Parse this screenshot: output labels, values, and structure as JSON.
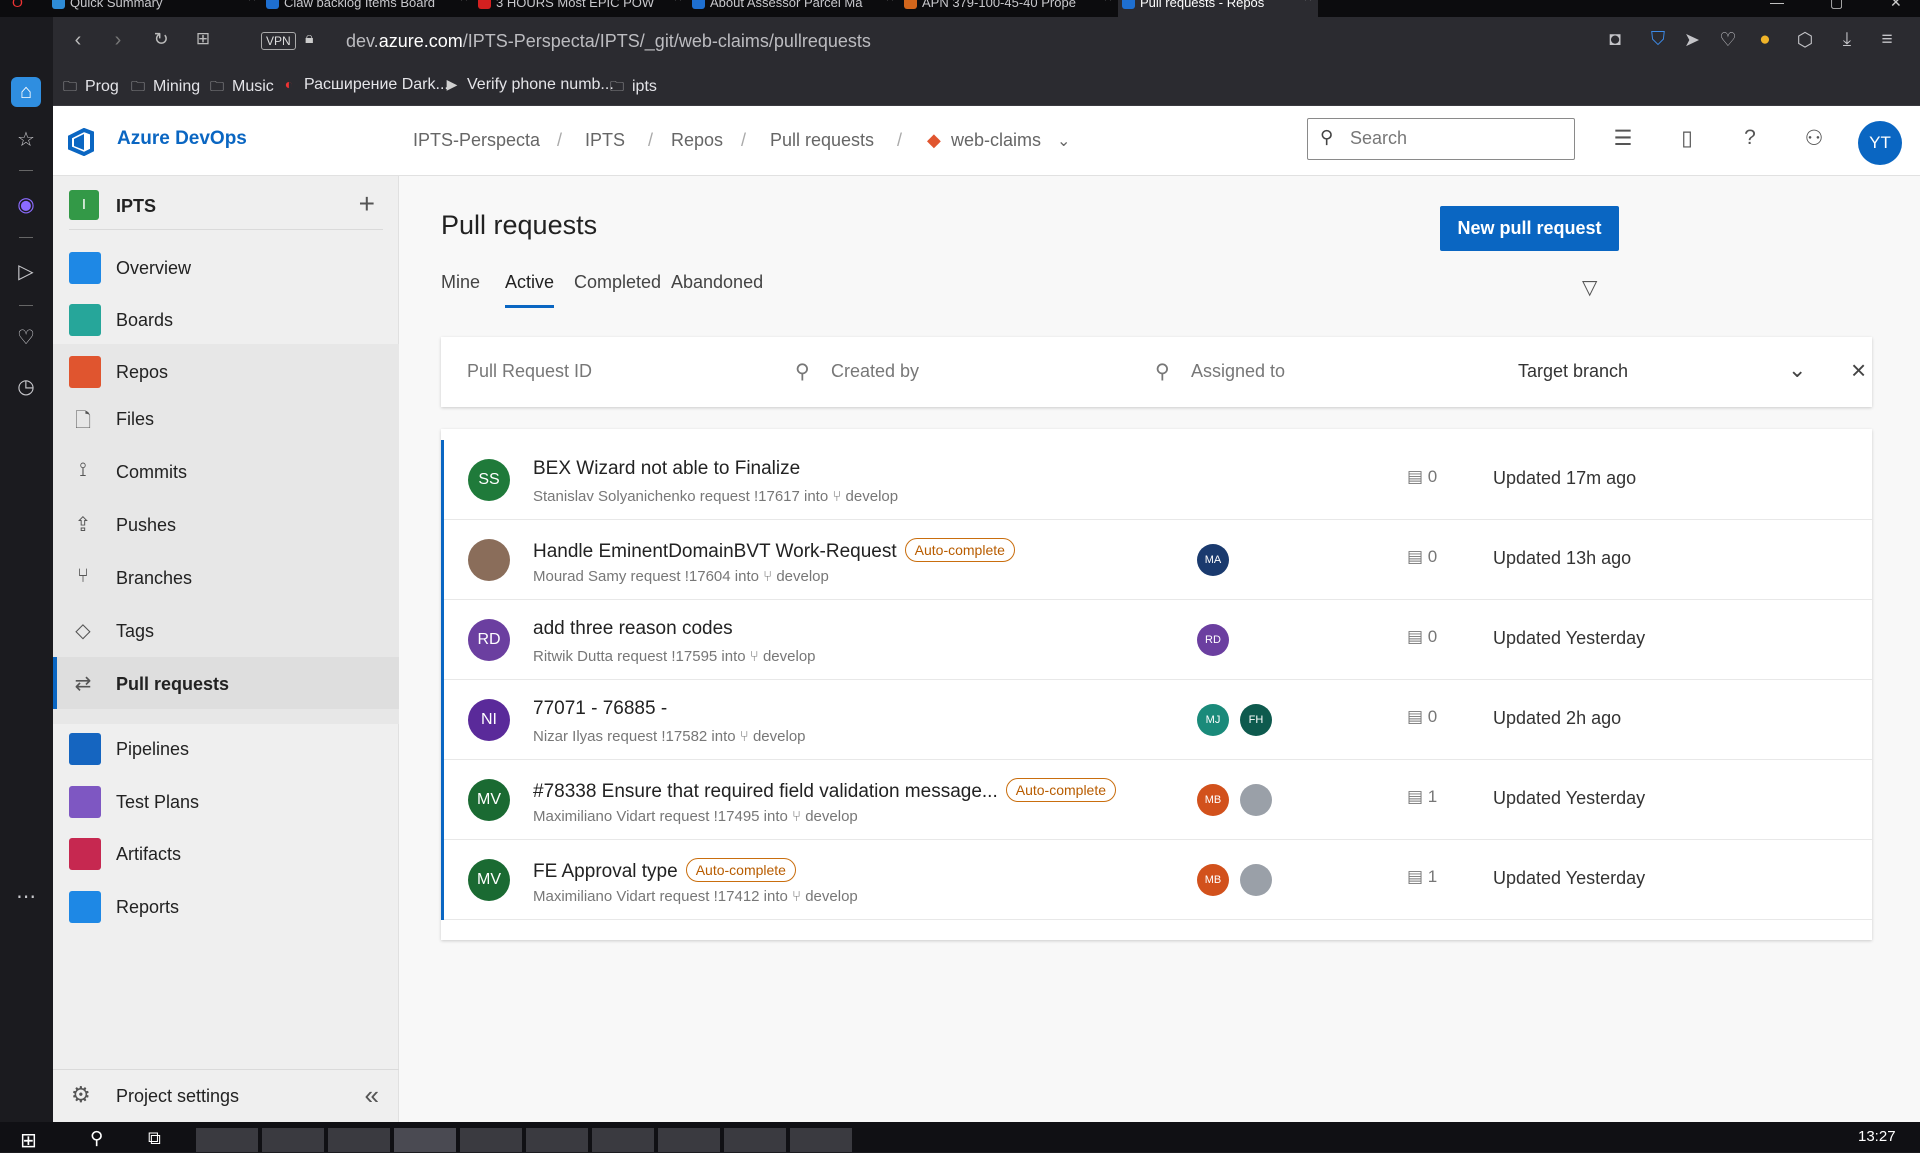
{
  "browser": {
    "tabs": [
      {
        "title": "Quick Summary",
        "color": "#2e8bd6"
      },
      {
        "title": "Claw backlog Items Board",
        "color": "#1e6fd0"
      },
      {
        "title": "3 HOURS Most EPIC POW",
        "color": "#d42020"
      },
      {
        "title": "About Assessor Parcel Ma",
        "color": "#1e6fd0"
      },
      {
        "title": "APN 379-100-45-40 Prope",
        "color": "#d2661c"
      },
      {
        "title": "Pull requests - Repos",
        "color": "#1e6fd0"
      }
    ],
    "url_prefix": "dev.",
    "url_domain": "azure.com",
    "url_path": "/IPTS-Perspecta/IPTS/_git/web-claims/pullrequests",
    "vpn_label": "VPN",
    "bookmarks": [
      {
        "label": "Prog",
        "icon": "folder-icon"
      },
      {
        "label": "Mining",
        "icon": "folder-icon"
      },
      {
        "label": "Music",
        "icon": "folder-icon"
      },
      {
        "label": "Расширение Dark...",
        "icon": "opera-icon"
      },
      {
        "label": "Verify phone numb...",
        "icon": "play-icon"
      },
      {
        "label": "ipts",
        "icon": "folder-icon"
      }
    ]
  },
  "header": {
    "brand": "Azure DevOps",
    "breadcrumbs": [
      "IPTS-Perspecta",
      "IPTS",
      "Repos",
      "Pull requests",
      "web-claims"
    ],
    "search_placeholder": "Search",
    "user_initials": "YT"
  },
  "sidebar": {
    "project_initial": "I",
    "project_name": "IPTS",
    "items": [
      {
        "label": "Overview",
        "color": "#1e88e5"
      },
      {
        "label": "Boards",
        "color": "#26a69a"
      },
      {
        "label": "Repos",
        "color": "#e0552f"
      },
      {
        "label": "Pipelines",
        "color": "#1565c0"
      },
      {
        "label": "Test Plans",
        "color": "#7e57c2"
      },
      {
        "label": "Artifacts",
        "color": "#c62850"
      },
      {
        "label": "Reports",
        "color": "#1e88e5"
      }
    ],
    "repo_subitems": [
      "Files",
      "Commits",
      "Pushes",
      "Branches",
      "Tags",
      "Pull requests"
    ],
    "project_settings": "Project settings"
  },
  "main": {
    "title": "Pull requests",
    "new_button": "New pull request",
    "tabs": [
      "Mine",
      "Active",
      "Completed",
      "Abandoned"
    ],
    "active_tab": "Active",
    "filters": {
      "pr_id": "Pull Request ID",
      "created_by": "Created by",
      "assigned_to": "Assigned to",
      "target_branch": "Target branch"
    },
    "pull_requests": [
      {
        "initials": "SS",
        "avatar_color": "#1f7a3a",
        "title": "BEX Wizard not able to Finalize",
        "auto_complete": false,
        "subtitle": "Stanislav Solyanichenko request !17617 into",
        "branch": "develop",
        "reviewers": [],
        "comments": "0",
        "updated": "Updated 17m ago"
      },
      {
        "initials": "",
        "avatar_color": "#8a6d5a",
        "title": "Handle EminentDomainBVT Work-Request",
        "auto_complete": true,
        "subtitle": "Mourad Samy request !17604 into",
        "branch": "develop",
        "reviewers": [
          {
            "initials": "MA",
            "color": "#1a3a6e"
          }
        ],
        "comments": "0",
        "updated": "Updated 13h ago"
      },
      {
        "initials": "RD",
        "avatar_color": "#6b3fa0",
        "title": "add three reason codes",
        "auto_complete": false,
        "subtitle": "Ritwik Dutta request !17595 into",
        "branch": "develop",
        "reviewers": [
          {
            "initials": "RD",
            "color": "#6b3fa0"
          }
        ],
        "comments": "0",
        "updated": "Updated Yesterday"
      },
      {
        "initials": "NI",
        "avatar_color": "#5a2a9a",
        "title": "77071 - 76885 -",
        "auto_complete": false,
        "subtitle": "Nizar Ilyas request !17582 into",
        "branch": "develop",
        "reviewers": [
          {
            "initials": "MJ",
            "color": "#1a8a7a"
          },
          {
            "initials": "FH",
            "color": "#0e5a4e"
          }
        ],
        "comments": "0",
        "updated": "Updated 2h ago"
      },
      {
        "initials": "MV",
        "avatar_color": "#1a6a32",
        "title": "#78338 Ensure that required field validation message...",
        "auto_complete": true,
        "subtitle": "Maximiliano Vidart request !17495 into",
        "branch": "develop",
        "reviewers": [
          {
            "initials": "MB",
            "color": "#d2511c"
          },
          {
            "initials": "",
            "color": "#9aa0a8"
          }
        ],
        "comments": "1",
        "updated": "Updated Yesterday"
      },
      {
        "initials": "MV",
        "avatar_color": "#1a6a32",
        "title": "FE Approval type",
        "auto_complete": true,
        "subtitle": "Maximiliano Vidart request !17412 into",
        "branch": "develop",
        "reviewers": [
          {
            "initials": "MB",
            "color": "#d2511c"
          },
          {
            "initials": "",
            "color": "#9aa0a8"
          }
        ],
        "comments": "1",
        "updated": "Updated Yesterday"
      }
    ],
    "auto_complete_label": "Auto-complete"
  },
  "taskbar": {
    "clock": "13:27"
  }
}
